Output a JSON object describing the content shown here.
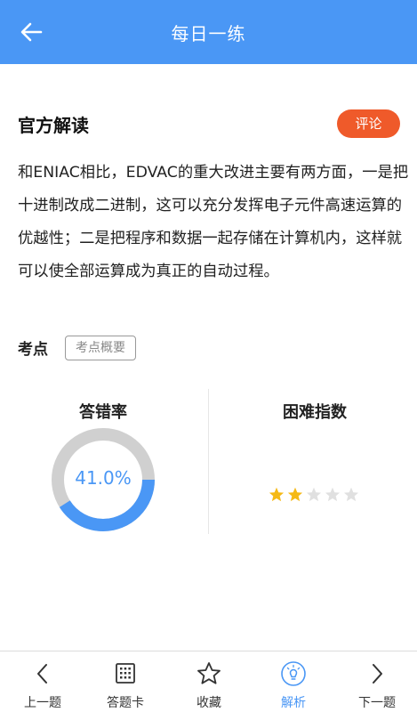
{
  "header": {
    "title": "每日一练",
    "back_icon": "arrow-left-icon"
  },
  "explanation": {
    "section_title": "官方解读",
    "comment_label": "评论",
    "text": "和ENIAC相比，EDVAC的重大改进主要有两方面，一是把十进制改成二进制，这可以充分发挥电子元件高速运算的优越性；二是把程序和数据一起存储在计算机内，这样就可以使全部运算成为真正的自动过程。"
  },
  "knowledge_point": {
    "label": "考点",
    "tag": "考点概要"
  },
  "stats": {
    "error_rate_label": "答错率",
    "error_rate_text": "41.0%",
    "error_rate_value": 41.0,
    "difficulty_label": "困难指数",
    "difficulty_stars": 2,
    "difficulty_max": 5
  },
  "colors": {
    "accent": "#4a97f5",
    "comment_button": "#ef5a2a",
    "star_filled": "#f5b915",
    "star_empty": "#e0e0e0",
    "ring_track": "#d0d0d0"
  },
  "bottom_nav": {
    "items": [
      {
        "label": "上一题",
        "icon": "chevron-left-icon",
        "active": false
      },
      {
        "label": "答题卡",
        "icon": "answer-card-icon",
        "active": false
      },
      {
        "label": "收藏",
        "icon": "star-outline-icon",
        "active": false
      },
      {
        "label": "解析",
        "icon": "lightbulb-icon",
        "active": true
      },
      {
        "label": "下一题",
        "icon": "chevron-right-icon",
        "active": false
      }
    ]
  }
}
